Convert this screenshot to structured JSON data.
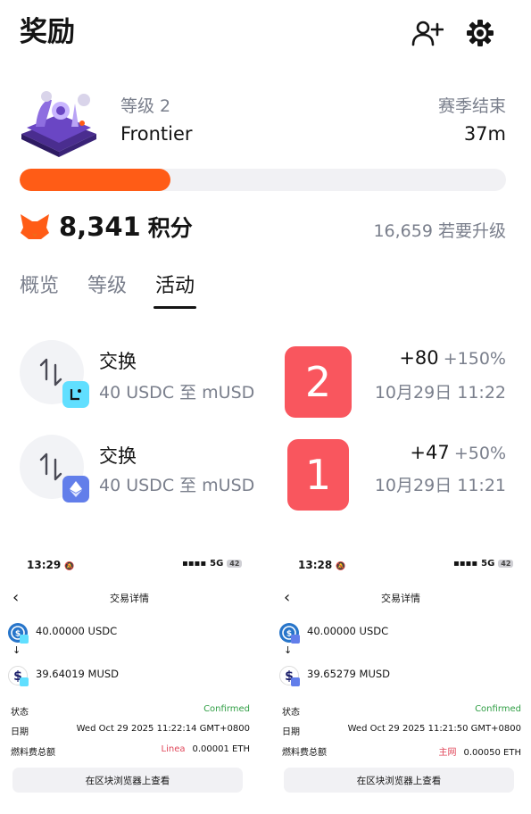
{
  "header": {
    "title": "奖励",
    "add_friend_icon": "person-add-icon",
    "settings_icon": "gear-icon"
  },
  "level": {
    "label": "等级 2",
    "name": "Frontier",
    "season_label": "赛季结束",
    "season_value": "37m",
    "progress_fraction": 0.31
  },
  "points": {
    "value": "8,341",
    "unit": "积分",
    "to_next": "16,659 若要升级"
  },
  "tabs": [
    {
      "label": "概览",
      "active": false
    },
    {
      "label": "等级",
      "active": false
    },
    {
      "label": "活动",
      "active": true
    }
  ],
  "activities": [
    {
      "title": "交换",
      "subtitle": "40 USDC 至 mUSD",
      "amount": "+80",
      "percent": "+150%",
      "time": "10月29日 11:22",
      "tag": "2",
      "network_icon": "linea-icon"
    },
    {
      "title": "交换",
      "subtitle": "40 USDC 至 mUSD",
      "amount": "+47",
      "percent": "+50%",
      "time": "10月29日 11:21",
      "tag": "1",
      "network_icon": "ethereum-icon"
    }
  ],
  "screenshots": [
    {
      "status_time": "13:29",
      "status_net": "5G",
      "status_batt": "42",
      "title": "交易详情",
      "from_amount": "40.00000 USDC",
      "to_amount": "39.64019 MUSD",
      "status_label": "状态",
      "status_value": "Confirmed",
      "date_label": "日期",
      "date_value": "Wed Oct 29 2025 11:22:14 GMT+0800",
      "fee_label": "燃料费总额",
      "network": "Linea",
      "fee_value": "0.00001 ETH",
      "button": "在区块浏览器上查看"
    },
    {
      "status_time": "13:28",
      "status_net": "5G",
      "status_batt": "42",
      "title": "交易详情",
      "from_amount": "40.00000 USDC",
      "to_amount": "39.65279 MUSD",
      "status_label": "状态",
      "status_value": "Confirmed",
      "date_label": "日期",
      "date_value": "Wed Oct 29 2025 11:21:50 GMT+0800",
      "fee_label": "燃料费总额",
      "network": "主网",
      "fee_value": "0.00050 ETH",
      "button": "在区块浏览器上查看"
    }
  ],
  "colors": {
    "accent": "#ff5c16",
    "tag": "#f9565e",
    "confirmed": "#2f9e44",
    "network": "#e0475a"
  }
}
